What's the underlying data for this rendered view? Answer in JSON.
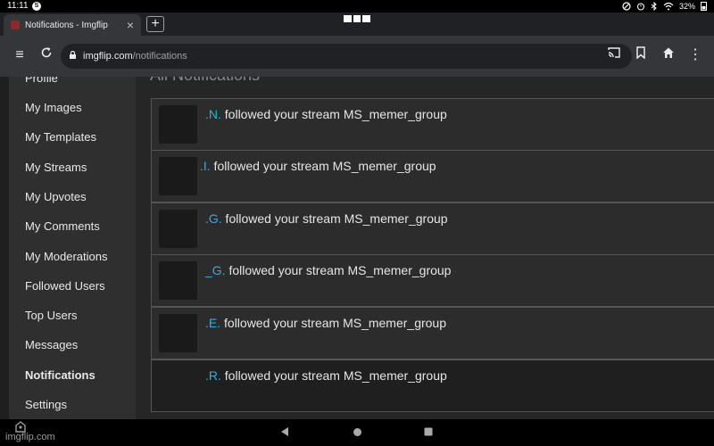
{
  "status_bar": {
    "time": "11:11",
    "badge": "S",
    "battery": "32%"
  },
  "browser": {
    "tab_title": "Notifications - Imgflip",
    "url_domain": "imgflip.com",
    "url_path": "/notifications"
  },
  "sidebar": {
    "items": [
      {
        "label": "Profile"
      },
      {
        "label": "My Images"
      },
      {
        "label": "My Templates"
      },
      {
        "label": "My Streams"
      },
      {
        "label": "My Upvotes"
      },
      {
        "label": "My Comments"
      },
      {
        "label": "My Moderations"
      },
      {
        "label": "Followed Users"
      },
      {
        "label": "Top Users"
      },
      {
        "label": "Messages"
      },
      {
        "label": "Notifications",
        "active": true
      },
      {
        "label": "Settings"
      }
    ]
  },
  "main": {
    "heading": "All Notifications",
    "notifications": [
      {
        "user": ".N.",
        "text": " followed your stream MS_memer_group"
      },
      {
        "user": ".I.",
        "text": " followed your stream MS_memer_group"
      },
      {
        "user": ".G.",
        "text": " followed your stream MS_memer_group"
      },
      {
        "user": "_G.",
        "text": " followed your stream MS_memer_group"
      },
      {
        "user": ".E.",
        "text": " followed your stream MS_memer_group"
      },
      {
        "user": ".R.",
        "text": " followed your stream MS_memer_group"
      }
    ]
  },
  "watermark": "imgflip.com",
  "colors": {
    "link": "#2bb0e6",
    "background": "#262626",
    "sidebar": "#2f2f2f"
  }
}
